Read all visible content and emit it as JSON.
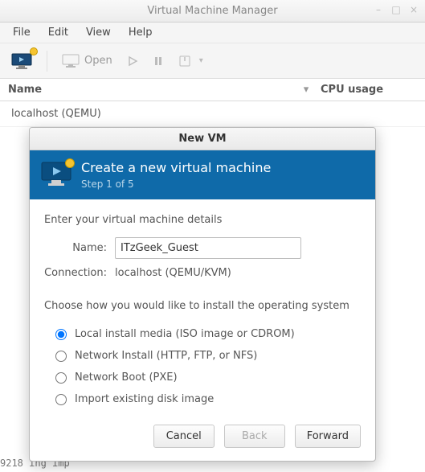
{
  "window": {
    "title": "Virtual Machine Manager"
  },
  "menubar": {
    "items": [
      "File",
      "Edit",
      "View",
      "Help"
    ]
  },
  "toolbar": {
    "open_label": "Open"
  },
  "columns": {
    "name": "Name",
    "cpu": "CPU usage"
  },
  "hosts": {
    "row0": "localhost (QEMU)"
  },
  "dialog": {
    "title": "New VM",
    "heading": "Create a new virtual machine",
    "step": "Step 1 of 5",
    "details_label": "Enter your virtual machine details",
    "name_label": "Name:",
    "name_value": "ITzGeek_Guest",
    "connection_label": "Connection:",
    "connection_value": "localhost (QEMU/KVM)",
    "install_label": "Choose how you would like to install the operating system",
    "options": {
      "local": "Local install media (ISO image or CDROM)",
      "network": "Network Install (HTTP, FTP, or NFS)",
      "pxe": "Network Boot (PXE)",
      "import": "Import existing disk image"
    },
    "buttons": {
      "cancel": "Cancel",
      "back": "Back",
      "forward": "Forward"
    }
  },
  "bg_terminal": "9218                                                              ing imp"
}
